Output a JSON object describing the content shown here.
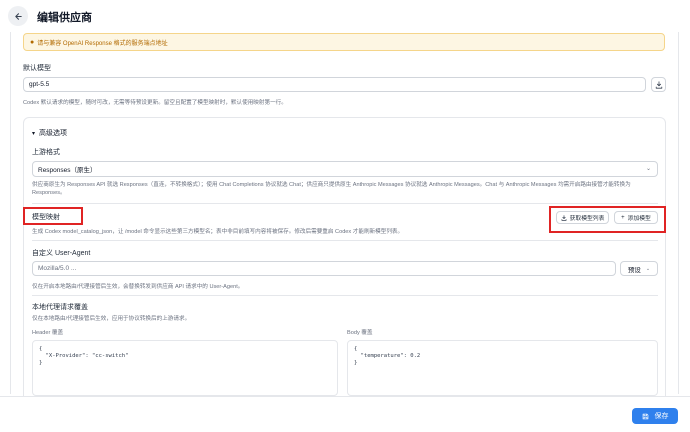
{
  "header": {
    "title": "编辑供应商",
    "back_icon": "arrow-left-icon"
  },
  "notice": {
    "text": "请与兼容 OpenAI Response 格式的服务端点地址"
  },
  "default_model": {
    "label": "默认模型",
    "value": "gpt-5.5",
    "hint": "Codex 默认请求的模型，随时可改，无需等待预设更新。留空且配置了模型映射时，默认使用映射第一行。"
  },
  "advanced": {
    "title": "高级选项",
    "upstream": {
      "label": "上游格式",
      "value": "Responses（原生）",
      "hint": "供应商原生为 Responses API 就选 Responses（直连，不转换格式）；使用 Chat Completions 协议就选 Chat；供应商只提供原生 Anthropic Messages 协议就选 Anthropic Messages。Chat 与 Anthropic Messages 均需开启路由接管才能转换为 Responses。"
    },
    "model_mapping": {
      "label": "模型映射",
      "hint": "生成 Codex model_catalog_json，让 /model 命令显示这些第三方模型名；表中非目前填写内容将被保存。修改后需要重启 Codex 才能刷新模型列表。",
      "fetch_label": "获取模型列表",
      "add_label": "添加模型"
    },
    "user_agent": {
      "label": "自定义 User-Agent",
      "placeholder": "Mozilla/5.0 ...",
      "preset_label": "预设",
      "hint": "仅在开启本地路由/代理接管后生效，会替换转发到供应商 API 请求中的 User-Agent。"
    },
    "proxy_override": {
      "label": "本地代理请求覆盖",
      "hint": "仅在本地路由/代理接管后生效，应用于协议转换后的上游请求。",
      "header_label": "Header 覆盖",
      "header_code": "{\n  \"X-Provider\": \"cc-switch\"\n}",
      "body_label": "Body 覆盖",
      "body_code": "{\n  \"temperature\": 0.2\n}"
    }
  },
  "footer": {
    "save_label": "保存"
  },
  "colors": {
    "accent": "#2f80ed",
    "highlight": "#e02424",
    "notice_bg": "#fdf6e3"
  }
}
